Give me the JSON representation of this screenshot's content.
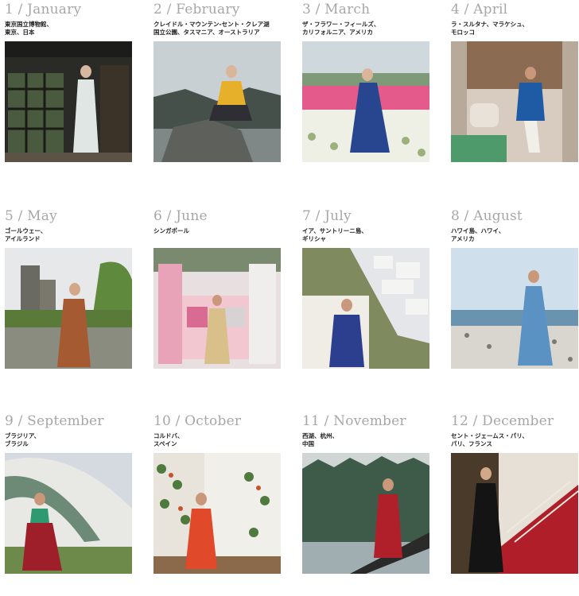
{
  "months": [
    {
      "title": "1 / January",
      "location": "東京国立博物館、\n東京、日本"
    },
    {
      "title": "2 / February",
      "location": "クレイドル・マウンテン-セント・クレア湖\n国立公園、タスマニア、オーストラリア"
    },
    {
      "title": "3 / March",
      "location": "ザ・フラワー・フィールズ、\nカリフォルニア、アメリカ"
    },
    {
      "title": "4 / April",
      "location": "ラ・スルタナ、マラケシュ、\nモロッコ"
    },
    {
      "title": "5 / May",
      "location": "ゴールウェー、\nアイルランド"
    },
    {
      "title": "6 / June",
      "location": "シンガポール"
    },
    {
      "title": "7 / July",
      "location": "イア、サントリーニ島、\nギリシャ"
    },
    {
      "title": "8 / August",
      "location": "ハワイ島、ハワイ、\nアメリカ"
    },
    {
      "title": "9 / September",
      "location": "ブラジリア、\nブラジル"
    },
    {
      "title": "10 / October",
      "location": "コルドバ、\nスペイン"
    },
    {
      "title": "11 / November",
      "location": "西湖、杭州、\n中国"
    },
    {
      "title": "12 / December",
      "location": "セント・ジェームス・パリ、\nパリ、フランス"
    }
  ]
}
